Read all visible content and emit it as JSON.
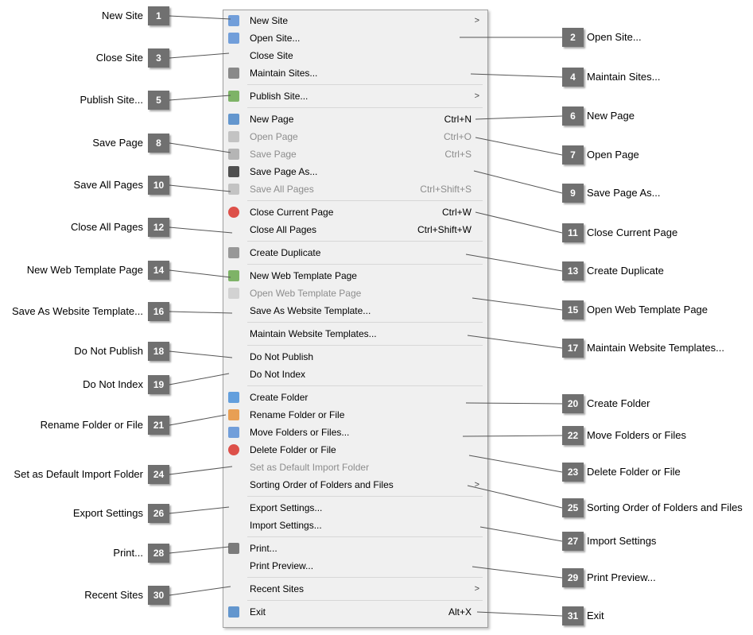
{
  "menu": {
    "items": [
      {
        "type": "item",
        "label": "New Site",
        "icon": "new-site-icon",
        "submenu": true
      },
      {
        "type": "item",
        "label": "Open Site...",
        "icon": "open-site-icon"
      },
      {
        "type": "item",
        "label": "Close Site"
      },
      {
        "type": "item",
        "label": "Maintain Sites...",
        "icon": "wrench-icon"
      },
      {
        "type": "sep"
      },
      {
        "type": "item",
        "label": "Publish Site...",
        "icon": "publish-icon",
        "submenu": true
      },
      {
        "type": "sep"
      },
      {
        "type": "item",
        "label": "New Page",
        "icon": "new-page-icon",
        "shortcut": "Ctrl+N"
      },
      {
        "type": "item",
        "label": "Open Page",
        "icon": "open-page-icon",
        "shortcut": "Ctrl+O",
        "disabled": true
      },
      {
        "type": "item",
        "label": "Save Page",
        "icon": "save-icon",
        "shortcut": "Ctrl+S",
        "disabled": true
      },
      {
        "type": "item",
        "label": "Save Page As...",
        "icon": "save-as-icon"
      },
      {
        "type": "item",
        "label": "Save All Pages",
        "icon": "save-all-icon",
        "shortcut": "Ctrl+Shift+S",
        "disabled": true
      },
      {
        "type": "sep"
      },
      {
        "type": "item",
        "label": "Close Current Page",
        "icon": "close-x-icon",
        "shortcut": "Ctrl+W"
      },
      {
        "type": "item",
        "label": "Close All Pages",
        "shortcut": "Ctrl+Shift+W"
      },
      {
        "type": "sep"
      },
      {
        "type": "item",
        "label": "Create Duplicate",
        "icon": "duplicate-icon"
      },
      {
        "type": "sep"
      },
      {
        "type": "item",
        "label": "New Web Template Page",
        "icon": "new-template-icon"
      },
      {
        "type": "item",
        "label": "Open Web Template Page",
        "icon": "open-template-icon",
        "disabled": true
      },
      {
        "type": "item",
        "label": "Save As Website Template..."
      },
      {
        "type": "sep"
      },
      {
        "type": "item",
        "label": "Maintain Website Templates..."
      },
      {
        "type": "sep"
      },
      {
        "type": "item",
        "label": "Do Not Publish"
      },
      {
        "type": "item",
        "label": "Do Not Index"
      },
      {
        "type": "sep"
      },
      {
        "type": "item",
        "label": "Create Folder",
        "icon": "create-folder-icon"
      },
      {
        "type": "item",
        "label": "Rename Folder or File",
        "icon": "rename-pencil-icon"
      },
      {
        "type": "item",
        "label": "Move Folders or Files...",
        "icon": "move-icon"
      },
      {
        "type": "item",
        "label": "Delete Folder or File",
        "icon": "delete-icon"
      },
      {
        "type": "item",
        "label": "Set as Default Import Folder",
        "disabled": true
      },
      {
        "type": "item",
        "label": "Sorting Order of Folders and Files",
        "submenu": true
      },
      {
        "type": "sep"
      },
      {
        "type": "item",
        "label": "Export Settings..."
      },
      {
        "type": "item",
        "label": "Import Settings..."
      },
      {
        "type": "sep"
      },
      {
        "type": "item",
        "label": "Print...",
        "icon": "printer-icon"
      },
      {
        "type": "item",
        "label": "Print Preview..."
      },
      {
        "type": "sep"
      },
      {
        "type": "item",
        "label": "Recent Sites",
        "submenu": true
      },
      {
        "type": "sep"
      },
      {
        "type": "item",
        "label": "Exit",
        "icon": "exit-icon",
        "shortcut": "Alt+X"
      }
    ],
    "submenu_arrow": ">"
  },
  "callouts_left": [
    {
      "num": "1",
      "label": "New Site"
    },
    {
      "num": "3",
      "label": "Close Site"
    },
    {
      "num": "5",
      "label": "Publish Site..."
    },
    {
      "num": "8",
      "label": "Save Page"
    },
    {
      "num": "10",
      "label": "Save All Pages"
    },
    {
      "num": "12",
      "label": "Close All Pages"
    },
    {
      "num": "14",
      "label": "New Web Template Page"
    },
    {
      "num": "16",
      "label": "Save As Website Template..."
    },
    {
      "num": "18",
      "label": "Do Not Publish"
    },
    {
      "num": "19",
      "label": "Do Not Index"
    },
    {
      "num": "21",
      "label": "Rename Folder or File"
    },
    {
      "num": "24",
      "label": "Set as Default Import Folder"
    },
    {
      "num": "26",
      "label": "Export Settings"
    },
    {
      "num": "28",
      "label": "Print..."
    },
    {
      "num": "30",
      "label": "Recent Sites"
    }
  ],
  "callouts_right": [
    {
      "num": "2",
      "label": "Open Site..."
    },
    {
      "num": "4",
      "label": "Maintain Sites..."
    },
    {
      "num": "6",
      "label": "New Page"
    },
    {
      "num": "7",
      "label": "Open Page"
    },
    {
      "num": "9",
      "label": "Save Page As..."
    },
    {
      "num": "11",
      "label": "Close Current Page"
    },
    {
      "num": "13",
      "label": "Create Duplicate"
    },
    {
      "num": "15",
      "label": "Open Web Template Page"
    },
    {
      "num": "17",
      "label": "Maintain Website Templates..."
    },
    {
      "num": "20",
      "label": "Create Folder"
    },
    {
      "num": "22",
      "label": "Move Folders or Files"
    },
    {
      "num": "23",
      "label": "Delete Folder or File"
    },
    {
      "num": "25",
      "label": "Sorting Order of Folders and Files"
    },
    {
      "num": "27",
      "label": "Import Settings"
    },
    {
      "num": "29",
      "label": "Print Preview..."
    },
    {
      "num": "31",
      "label": "Exit"
    }
  ],
  "colors": {
    "callout_box": "#707070",
    "menu_bg": "#f0f0f0",
    "disabled_text": "#8d8d8d"
  }
}
